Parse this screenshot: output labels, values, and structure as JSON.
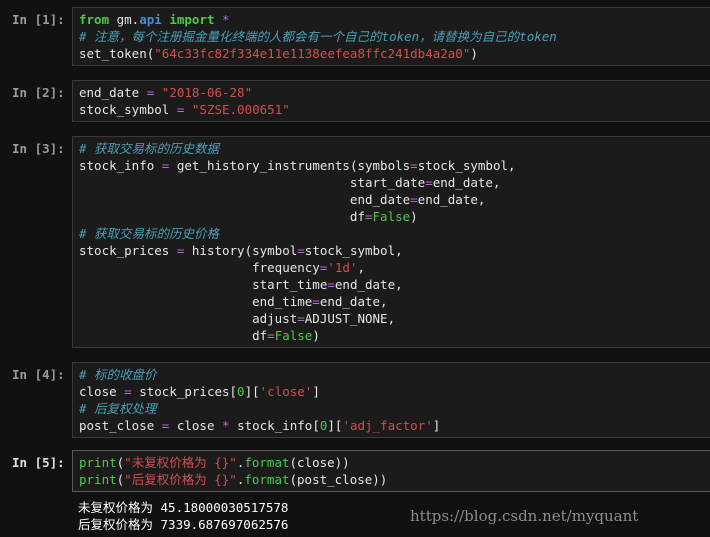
{
  "cells": [
    {
      "prompt": "In [1]:",
      "lines": [
        [
          [
            "kw",
            "from"
          ],
          [
            "id",
            " gm."
          ],
          [
            "mod",
            "api"
          ],
          [
            "id",
            " "
          ],
          [
            "kw",
            "import"
          ],
          [
            "id",
            " "
          ],
          [
            "op",
            "*"
          ]
        ],
        [
          [
            "cm",
            "# 注意，每个注册掘金量化终端的人都会有一个自己的token，请替换为自己的token"
          ]
        ],
        [
          [
            "id",
            "set_token("
          ],
          [
            "str",
            "\"64c33fc82f334e11e1138eefea8ffc241db4a2a0\""
          ],
          [
            "id",
            ")"
          ]
        ]
      ]
    },
    {
      "prompt": "In [2]:",
      "lines": [
        [
          [
            "id",
            "end_date "
          ],
          [
            "op",
            "="
          ],
          [
            "id",
            " "
          ],
          [
            "str",
            "\"2018-06-28\""
          ]
        ],
        [
          [
            "id",
            "stock_symbol "
          ],
          [
            "op",
            "="
          ],
          [
            "id",
            " "
          ],
          [
            "str",
            "\"SZSE.000651\""
          ]
        ]
      ]
    },
    {
      "prompt": "In [3]:",
      "lines": [
        [
          [
            "cm",
            "# 获取交易标的历史数据"
          ]
        ],
        [
          [
            "id",
            "stock_info "
          ],
          [
            "op",
            "="
          ],
          [
            "id",
            " get_history_instruments(symbols"
          ],
          [
            "op",
            "="
          ],
          [
            "id",
            "stock_symbol,"
          ]
        ],
        [
          [
            "id",
            "                                    start_date"
          ],
          [
            "op",
            "="
          ],
          [
            "id",
            "end_date,"
          ]
        ],
        [
          [
            "id",
            "                                    end_date"
          ],
          [
            "op",
            "="
          ],
          [
            "id",
            "end_date,"
          ]
        ],
        [
          [
            "id",
            "                                    df"
          ],
          [
            "op",
            "="
          ],
          [
            "kwc",
            "False"
          ],
          [
            "id",
            ")"
          ]
        ],
        [
          [
            "cm",
            "# 获取交易标的历史价格"
          ]
        ],
        [
          [
            "id",
            "stock_prices "
          ],
          [
            "op",
            "="
          ],
          [
            "id",
            " history(symbol"
          ],
          [
            "op",
            "="
          ],
          [
            "id",
            "stock_symbol,"
          ]
        ],
        [
          [
            "id",
            "                       frequency"
          ],
          [
            "op",
            "="
          ],
          [
            "str",
            "'1d'"
          ],
          [
            "id",
            ","
          ]
        ],
        [
          [
            "id",
            "                       start_time"
          ],
          [
            "op",
            "="
          ],
          [
            "id",
            "end_date,"
          ]
        ],
        [
          [
            "id",
            "                       end_time"
          ],
          [
            "op",
            "="
          ],
          [
            "id",
            "end_date,"
          ]
        ],
        [
          [
            "id",
            "                       adjust"
          ],
          [
            "op",
            "="
          ],
          [
            "id",
            "ADJUST_NONE,"
          ]
        ],
        [
          [
            "id",
            "                       df"
          ],
          [
            "op",
            "="
          ],
          [
            "kwc",
            "False"
          ],
          [
            "id",
            ")"
          ]
        ]
      ]
    },
    {
      "prompt": "In [4]:",
      "lines": [
        [
          [
            "cm",
            "# 标的收盘价"
          ]
        ],
        [
          [
            "id",
            "close "
          ],
          [
            "op",
            "="
          ],
          [
            "id",
            " stock_prices["
          ],
          [
            "kwc",
            "0"
          ],
          [
            "id",
            "]["
          ],
          [
            "str",
            "'close'"
          ],
          [
            "id",
            "]"
          ]
        ],
        [
          [
            "cm",
            "# 后复权处理"
          ]
        ],
        [
          [
            "id",
            "post_close "
          ],
          [
            "op",
            "="
          ],
          [
            "id",
            " close "
          ],
          [
            "op",
            "*"
          ],
          [
            "id",
            " stock_info["
          ],
          [
            "kwc",
            "0"
          ],
          [
            "id",
            "]["
          ],
          [
            "str",
            "'adj_factor'"
          ],
          [
            "id",
            "]"
          ]
        ]
      ]
    },
    {
      "prompt": "In [5]:",
      "lines": [
        [
          [
            "kwc",
            "print"
          ],
          [
            "id",
            "("
          ],
          [
            "str",
            "\"未复权价格为 {}\""
          ],
          [
            "id",
            "."
          ],
          [
            "kwc",
            "format"
          ],
          [
            "id",
            "(close))"
          ]
        ],
        [
          [
            "kwc",
            "print"
          ],
          [
            "id",
            "("
          ],
          [
            "str",
            "\"后复权价格为 {}\""
          ],
          [
            "id",
            "."
          ],
          [
            "kwc",
            "format"
          ],
          [
            "id",
            "(post_close))"
          ]
        ]
      ]
    }
  ],
  "output": [
    "未复权价格为 45.1800003051757​8",
    "后复权价格为 7339.687697062576"
  ],
  "watermark": "https://blog.csdn.net/myquant"
}
